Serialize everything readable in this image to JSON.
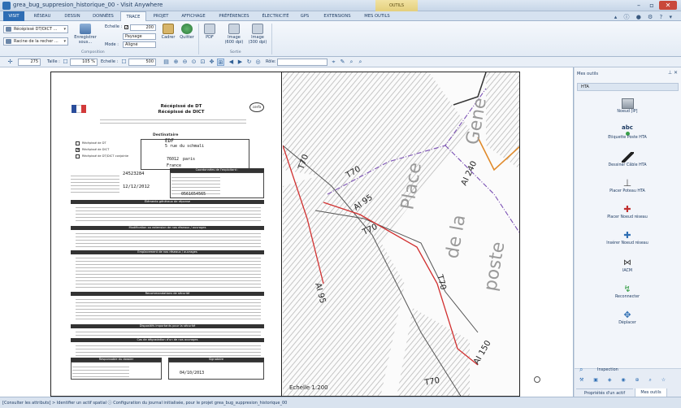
{
  "window": {
    "title": "grea_bug_suppresion_historique_00 - Visit Anywhere",
    "context_tab": "OUTILS"
  },
  "tabs": [
    {
      "label": "VISIT"
    },
    {
      "label": "RÉSEAU"
    },
    {
      "label": "DESSIN"
    },
    {
      "label": "DONNÉES"
    },
    {
      "label": "TRACE"
    },
    {
      "label": "PROJET"
    },
    {
      "label": "AFFICHAGE"
    },
    {
      "label": "PRÉFÉRENCES"
    },
    {
      "label": "ÉLECTRICITÉ"
    },
    {
      "label": "GPS"
    },
    {
      "label": "EXTENSIONS"
    },
    {
      "label": "MES OUTILS"
    }
  ],
  "ribbon": {
    "select1": "Récépissé DT/DICT ...",
    "select2": "Racine de la recher ...",
    "save_label": "Enregistrer sous...",
    "scale_label": "Echelle :",
    "scale_value": "200",
    "format_value": "Paysage",
    "mode_label": "Mode :",
    "mode_value": "Aligné",
    "frame_label": "Cadrer",
    "quit_label": "Quitter",
    "pdf_label": "PDF",
    "image600_label": "Image (600 dpi)",
    "image300_label": "Image (300 dpi)",
    "group_composition": "Composition",
    "group_sortie": "Sortie"
  },
  "toolbar": {
    "value1": "275",
    "taille_label": "Taille :",
    "taille_value": "105 %",
    "echelle_label": "Echelle :",
    "echelle_value": "500",
    "role_label": "Rôle:"
  },
  "form": {
    "title_line1": "Récépissé de DT",
    "title_line2": "Récépissé de DICT",
    "cerfa": "cerfa",
    "destinataire": "Destinataire",
    "dest_name": "EDF",
    "dest_street": "5 rue du schmali",
    "dest_cp": "76012",
    "dest_city": "paris",
    "dest_country": "France",
    "opt_dt": "Récépissé de DT",
    "opt_dict": "Récépissé de DICT",
    "opt_conj": "Récépissé de DT/DICT conjointe",
    "consultation_no": "24523284",
    "date_value": "12/12/2012",
    "coord_header": "Coordonnées de l'exploitant :",
    "phone": "0561654565",
    "sec1": "Éléments généraux de réponse",
    "sec2": "Modification ou extension de nos réseaux / ouvrages",
    "sec3": "Emplacement de nos réseaux / ouvrages",
    "sec4": "Recommandations de sécurité",
    "sec5": "Dispositifs importants pour la sécurité",
    "sec6": "Cas de dégradation d'un de nos ouvrages",
    "resp_header": "Responsable du dossier",
    "sign_header": "Signataire",
    "sign_date": "04/10/2013"
  },
  "map": {
    "labels": [
      "T70",
      "T70",
      "AI 95",
      "AI 240",
      "T70",
      "AI 95",
      "T70",
      "AI 150",
      "T70",
      "Place",
      "de la",
      "Gene",
      "poste"
    ],
    "scale_text": "Echelle 1:200"
  },
  "dock": {
    "title": "Mes outils",
    "subgroup": "HTA",
    "tools": [
      {
        "label": "Noeud [IP]"
      },
      {
        "label": "Etiquette Poste HTA"
      },
      {
        "label": "Dessiner Câble HTA"
      },
      {
        "label": "Placer Poteau HTA"
      },
      {
        "label": "Placer Noeud réseau"
      },
      {
        "label": "Insérer Noeud réseau"
      },
      {
        "label": "IACM"
      },
      {
        "label": "Reconnecter"
      },
      {
        "label": "Déplacer"
      }
    ],
    "inspection_label": "Inspection",
    "tab_properties": "Propriétés d'un actif",
    "tab_mytools": "Mes outils"
  },
  "status": {
    "text": "[Consulter les attributs] > Identifier un actif spatial   ⓘ Configuration du journal initialisée, pour le projet grea_bug_suppresion_historique_00"
  }
}
